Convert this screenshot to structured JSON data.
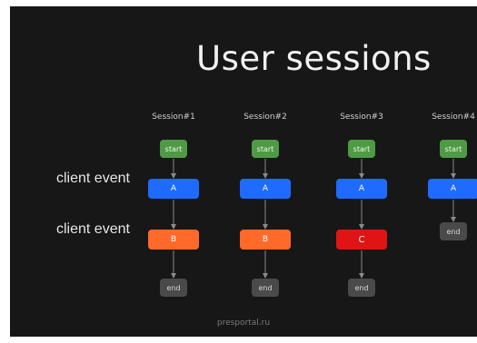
{
  "title": "User sessions",
  "row_labels": [
    "client event",
    "client event"
  ],
  "sessions": [
    {
      "label": "Session#1",
      "nodes": [
        "start",
        "A",
        "B",
        "end"
      ],
      "kinds": [
        "start",
        "a",
        "b",
        "end"
      ]
    },
    {
      "label": "Session#2",
      "nodes": [
        "start",
        "A",
        "B",
        "end"
      ],
      "kinds": [
        "start",
        "a",
        "b",
        "end"
      ]
    },
    {
      "label": "Session#3",
      "nodes": [
        "start",
        "A",
        "C",
        "end"
      ],
      "kinds": [
        "start",
        "a",
        "c",
        "end"
      ]
    },
    {
      "label": "Session#4",
      "nodes": [
        "start",
        "A",
        "end"
      ],
      "kinds": [
        "start",
        "a",
        "end"
      ]
    }
  ],
  "watermark": "presportal.ru",
  "colors": {
    "background": "#171717",
    "start": "#4f9a45",
    "a": "#1f6bff",
    "b": "#ff6a2a",
    "c": "#e01414",
    "end": "#4a4a4a",
    "arrow": "#8a8a8a"
  }
}
